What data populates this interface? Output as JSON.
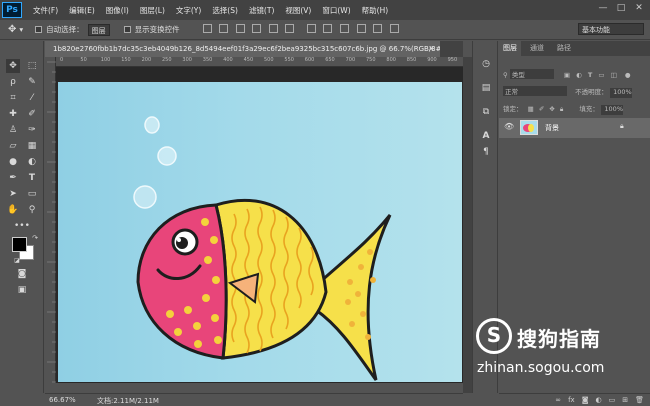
{
  "app": {
    "logo": "Ps"
  },
  "menu": {
    "items": [
      "文件(F)",
      "编辑(E)",
      "图像(I)",
      "图层(L)",
      "文字(Y)",
      "选择(S)",
      "滤镜(T)",
      "视图(V)",
      "窗口(W)",
      "帮助(H)"
    ]
  },
  "window_controls": {
    "minimize": "—",
    "restore": "□",
    "close": "✕"
  },
  "options": {
    "auto_select_label": "自动选择：",
    "auto_select_value": "图层",
    "show_transform_label": "显示变换控件",
    "workspace": "基本功能"
  },
  "document": {
    "tab_title": "1b820e2760fbb1b7dc35c3eb4049b126_8d5494eef01f3a29ec6f2bea9325bc315c607c6b.jpg @ 66.7%(RGB/8#)",
    "close": "×"
  },
  "ruler": {
    "h_labels": [
      "0",
      "50",
      "100",
      "150",
      "200",
      "250",
      "300",
      "350",
      "400",
      "450",
      "500",
      "550",
      "600",
      "650",
      "700",
      "750",
      "800",
      "850",
      "900",
      "950"
    ]
  },
  "status": {
    "zoom": "66.67%",
    "doc_info": "文档:2.11M/2.11M"
  },
  "layers_panel": {
    "tabs": [
      "图层",
      "通道",
      "路径"
    ],
    "filter_label": "类型",
    "blend_mode": "正常",
    "opacity_label": "不透明度：",
    "opacity_value": "100%",
    "lock_label": "锁定：",
    "fill_label": "填充：",
    "fill_value": "100%",
    "layer_name": "背景"
  },
  "watermark": {
    "logo": "S",
    "brand": "搜狗指南",
    "url": "zhinan.sogou.com"
  },
  "colors": {
    "sky_top": "#8fcfe4",
    "sky_bottom": "#b4e2ec",
    "fish_pink": "#e8457a",
    "fish_yellow": "#f6e04a",
    "spots": "#f4d23c"
  }
}
